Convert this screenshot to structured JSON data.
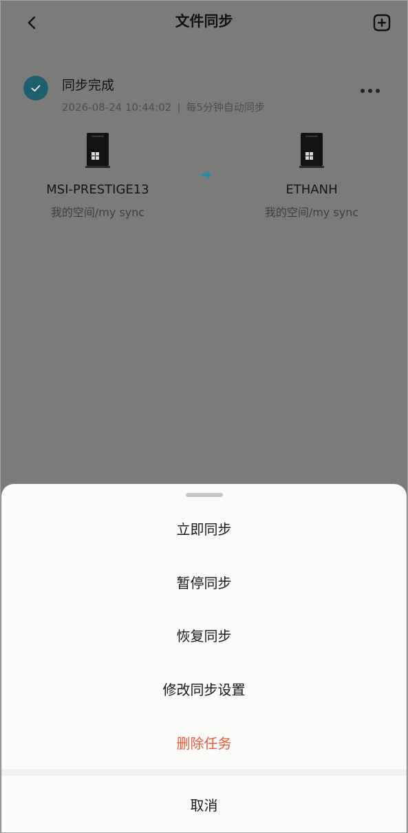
{
  "header": {
    "title": "文件同步",
    "back_icon": "chevron-left-icon",
    "add_icon": "add-square-icon"
  },
  "task": {
    "status": "同步完成",
    "datetime": "2026-08-24 10:44:02",
    "separator": "|",
    "schedule": "每5分钟自动同步",
    "more_icon": "more-horizontal-icon",
    "status_color": "#1f5f6d",
    "source": {
      "name": "MSI-PRESTIGE13",
      "path": "我的空间/my sync",
      "icon": "pc-tower-icon"
    },
    "target": {
      "name": "ETHANH",
      "path": "我的空间/my sync",
      "icon": "pc-tower-icon"
    },
    "arrow_icon": "sync-arrow-icon",
    "arrow_color": "#2b8aa2"
  },
  "sheet": {
    "items": [
      {
        "label": "立即同步"
      },
      {
        "label": "暂停同步"
      },
      {
        "label": "恢复同步"
      },
      {
        "label": "修改同步设置"
      },
      {
        "label": "删除任务"
      }
    ],
    "cancel_label": "取消",
    "danger_color": "#ea5b3b"
  }
}
